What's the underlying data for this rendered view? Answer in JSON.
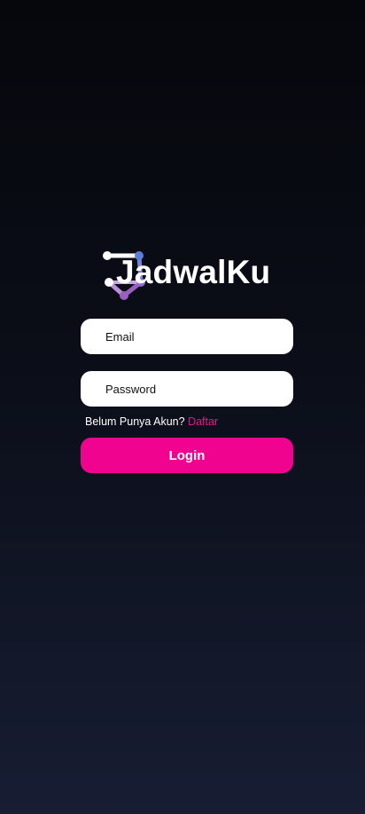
{
  "app": {
    "logo_text": "JadwalKu"
  },
  "login_form": {
    "email_placeholder": "Email",
    "password_placeholder": "Password",
    "register_prompt": "Belum Punya Akun?",
    "register_link": "Daftar",
    "login_label": "Login"
  },
  "colors": {
    "background_top": "#06070c",
    "background_bottom": "#171d33",
    "accent": "#f0048f",
    "link": "#e6168b",
    "logo_blue": "#5b7fd4",
    "logo_purple": "#9b5fc0"
  },
  "icons": {
    "logo_mark": "network-nodes-icon"
  }
}
